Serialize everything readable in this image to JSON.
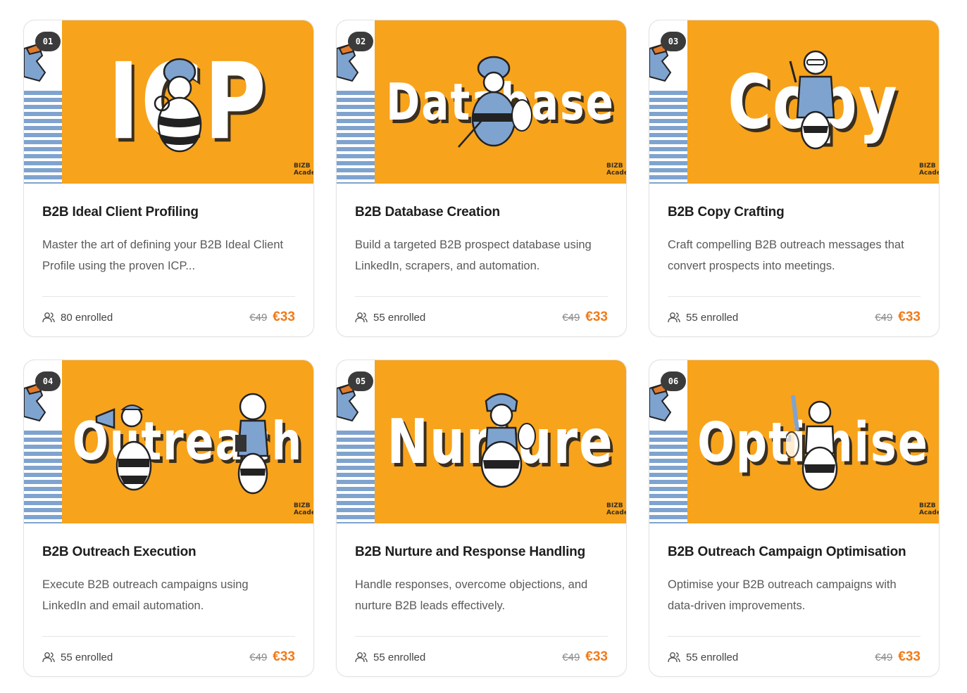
{
  "theme": {
    "card_bg": "#f7a31c",
    "stripe": "#7fa3cf",
    "price_accent": "#f07a1a",
    "badge": "#3b3b3b"
  },
  "logo": "BIZB Acade",
  "courses": [
    {
      "number": "01",
      "thumb_word": "ICP",
      "title": "B2B Ideal Client Profiling",
      "description": "Master the art of defining your B2B Ideal Client Profile using the proven ICP...",
      "enrolled": "80 enrolled",
      "old_price": "€49",
      "price": "€33"
    },
    {
      "number": "02",
      "thumb_word": "Database",
      "title": "B2B Database Creation",
      "description": "Build a targeted B2B prospect database using LinkedIn, scrapers, and automation.",
      "enrolled": "55 enrolled",
      "old_price": "€49",
      "price": "€33"
    },
    {
      "number": "03",
      "thumb_word": "Copy",
      "title": "B2B Copy Crafting",
      "description": "Craft compelling B2B outreach messages that convert prospects into meetings.",
      "enrolled": "55 enrolled",
      "old_price": "€49",
      "price": "€33"
    },
    {
      "number": "04",
      "thumb_word": "Outreach",
      "title": "B2B Outreach Execution",
      "description": "Execute B2B outreach campaigns using LinkedIn and email automation.",
      "enrolled": "55 enrolled",
      "old_price": "€49",
      "price": "€33"
    },
    {
      "number": "05",
      "thumb_word": "Nurture",
      "title": "B2B Nurture and Response Handling",
      "description": "Handle responses, overcome objections, and nurture B2B leads effectively.",
      "enrolled": "55 enrolled",
      "old_price": "€49",
      "price": "€33"
    },
    {
      "number": "06",
      "thumb_word": "Optimise",
      "title": "B2B Outreach Campaign Optimisation",
      "description": "Optimise your B2B outreach campaigns with data-driven improvements.",
      "enrolled": "55 enrolled",
      "old_price": "€49",
      "price": "€33"
    }
  ]
}
